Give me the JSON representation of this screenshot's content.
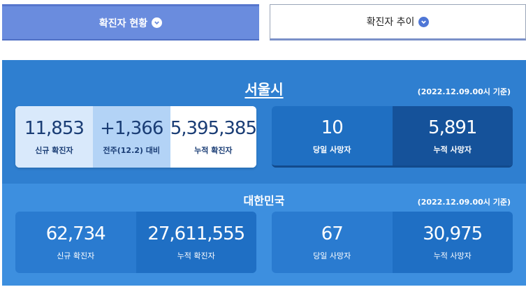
{
  "tabs": {
    "active_label": "확진자 현황",
    "inactive_label": "확진자 추이"
  },
  "seoul": {
    "title": "서울시",
    "ref_date": "(2022.12.09.00시 기준)",
    "new_cases": "11,853",
    "new_cases_label": "신규 확진자",
    "weekly_change": "+1,366",
    "weekly_change_label": "전주(12.2) 대비",
    "total_cases": "5,395,385",
    "total_cases_label": "누적 확진자",
    "daily_deaths": "10",
    "daily_deaths_label": "당일 사망자",
    "total_deaths": "5,891",
    "total_deaths_label": "누적 사망자"
  },
  "korea": {
    "title": "대한민국",
    "ref_date": "(2022.12.09.00시 기준)",
    "new_cases": "62,734",
    "new_cases_label": "신규 확진자",
    "total_cases": "27,611,555",
    "total_cases_label": "누적 확진자",
    "daily_deaths": "67",
    "daily_deaths_label": "당일 사망자",
    "total_deaths": "30,975",
    "total_deaths_label": "누적 사망자"
  },
  "icons": {
    "tab_chevron": "chevron-down-icon"
  },
  "colors": {
    "active_tab": "#6a8cde",
    "seoul_panel": "#2f7fd0",
    "korea_panel": "#3d8fdf"
  }
}
